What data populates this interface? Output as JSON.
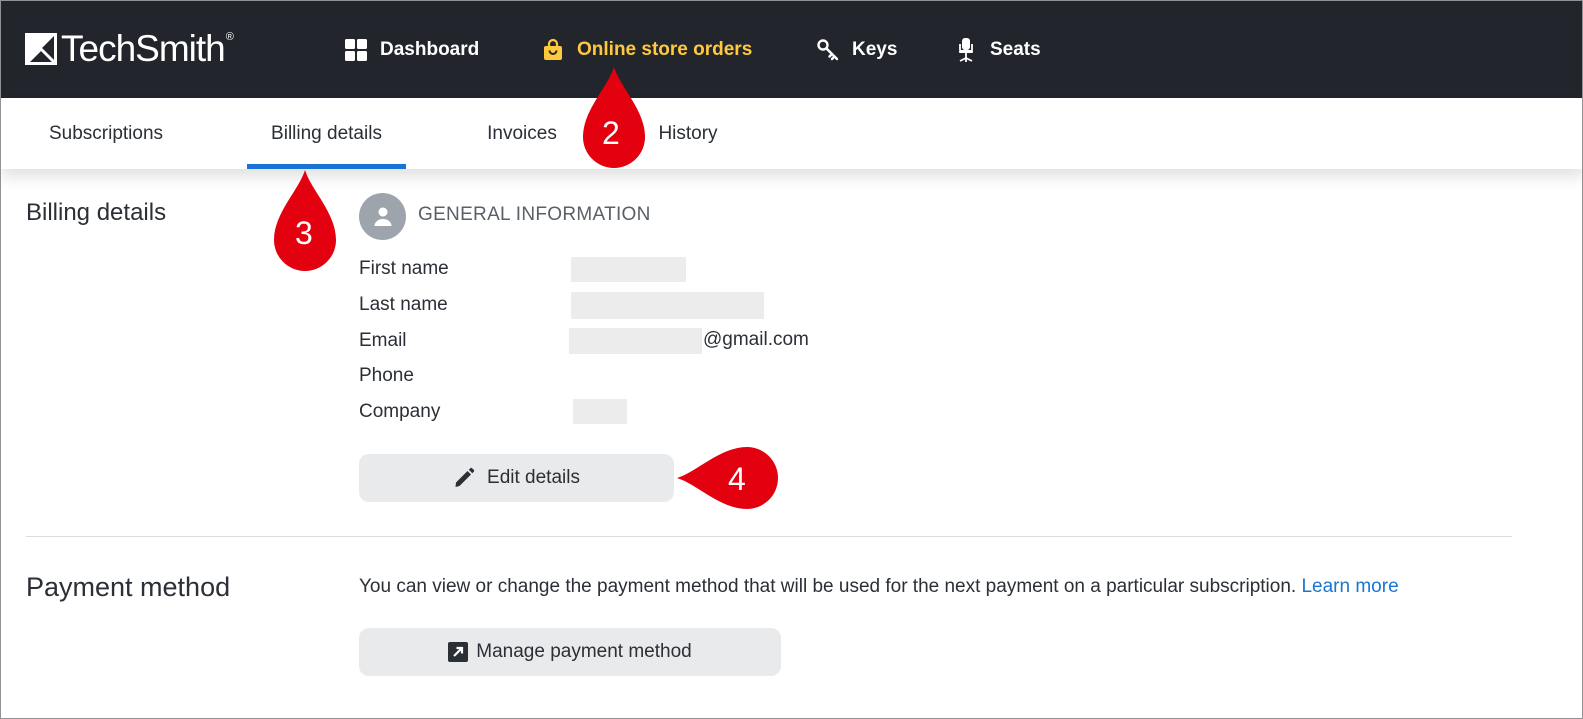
{
  "brand": {
    "name": "TechSmith",
    "reg": "®"
  },
  "nav": {
    "items": [
      {
        "label": "Dashboard",
        "icon": "grid-icon"
      },
      {
        "label": "Online store orders",
        "icon": "shopping-bag-icon",
        "active": true
      },
      {
        "label": "Keys",
        "icon": "key-icon"
      },
      {
        "label": "Seats",
        "icon": "seat-icon"
      }
    ]
  },
  "tabs": [
    {
      "label": "Subscriptions"
    },
    {
      "label": "Billing details",
      "active": true
    },
    {
      "label": "Invoices"
    },
    {
      "label": "History"
    }
  ],
  "billing": {
    "title": "Billing details",
    "general_info": "GENERAL INFORMATION",
    "fields": {
      "first_name": "First name",
      "last_name": "Last name",
      "email": "Email",
      "phone": "Phone",
      "company": "Company"
    },
    "email_suffix": "@gmail.com",
    "edit_button": "Edit details"
  },
  "payment": {
    "title": "Payment method",
    "description": "You can view or change the payment method that will be used for the next payment on a particular subscription.",
    "link": "Learn more",
    "button": "Manage payment method"
  },
  "callouts": {
    "two": "2",
    "three": "3",
    "four": "4"
  },
  "colors": {
    "topbar": "#22262c",
    "active_nav": "#ffc83d",
    "active_tab": "#1a74d6",
    "callout": "#e3000f",
    "link": "#1a74d6"
  }
}
